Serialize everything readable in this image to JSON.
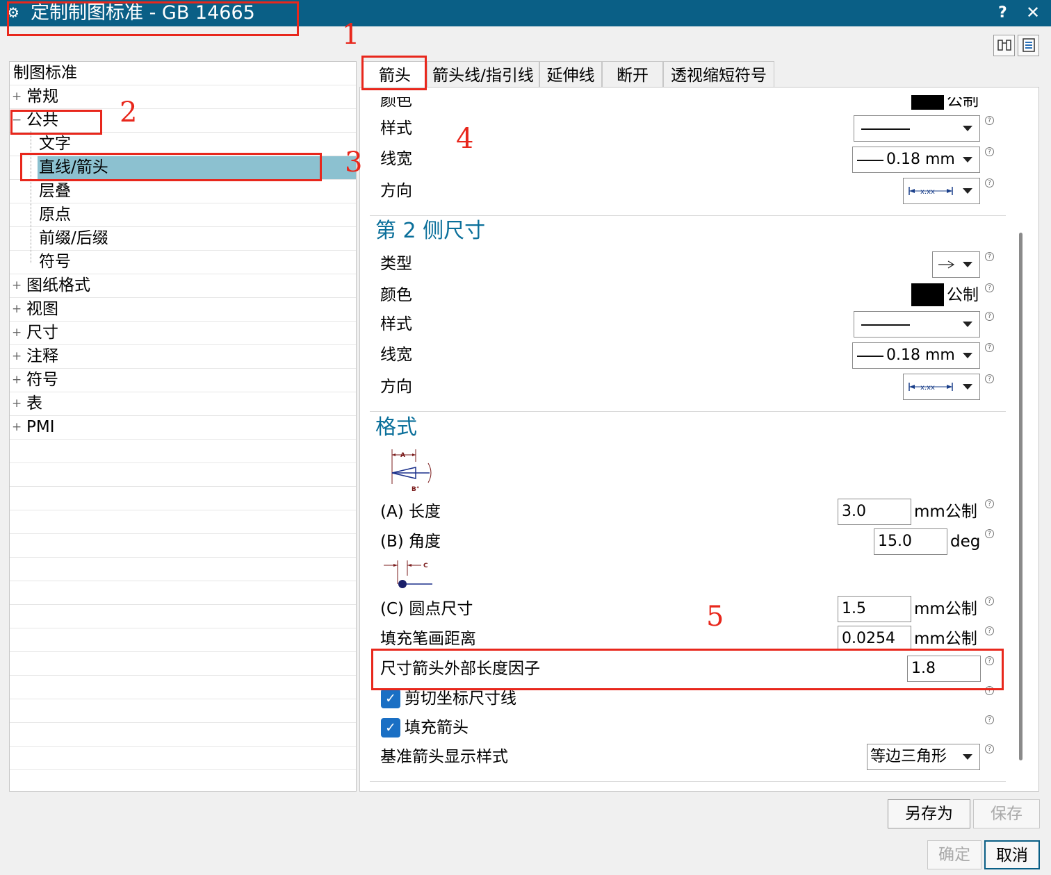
{
  "title": "定制制图标准 - GB 14665",
  "window_controls": {
    "help": "?",
    "close": "✕"
  },
  "toolbar": {
    "icon1": "binoculars-icon",
    "icon2": "list-icon"
  },
  "tree": {
    "root": "制图标准",
    "items": [
      "常规",
      "公共",
      "文字",
      "直线/箭头",
      "层叠",
      "原点",
      "前缀/后缀",
      "符号",
      "图纸格式",
      "视图",
      "尺寸",
      "注释",
      "符号",
      "表",
      "PMI"
    ],
    "selected": "直线/箭头"
  },
  "tabs": [
    "箭头",
    "箭头线/指引线",
    "延伸线",
    "断开",
    "透视缩短符号"
  ],
  "active_tab": "箭头",
  "side1": {
    "color_label": "颜色",
    "color_value": "公制",
    "style_label": "样式",
    "width_label": "线宽",
    "width_value": "0.18 mm",
    "dir_label": "方向"
  },
  "side2": {
    "heading": "第 2 侧尺寸",
    "type_label": "类型",
    "color_label": "颜色",
    "color_value": "公制",
    "style_label": "样式",
    "width_label": "线宽",
    "width_value": "0.18 mm",
    "dir_label": "方向"
  },
  "format": {
    "heading": "格式",
    "diagram1": {
      "a": "A",
      "b": "B°"
    },
    "diagram2": {
      "c": "C"
    },
    "length_label": "(A) 长度",
    "length_value": "3.0",
    "length_unit": "mm",
    "angle_label": "(B) 角度",
    "angle_value": "15.0",
    "angle_unit": "deg",
    "dot_label": "(C) 圆点尺寸",
    "dot_value": "1.5",
    "dot_unit": "mm",
    "fill_label": "填充笔画距离",
    "fill_value": "0.0254",
    "fill_unit": "mm",
    "factor_label": "尺寸箭头外部长度因子",
    "factor_value": "1.8",
    "clip_label": "剪切坐标尺寸线",
    "clip_checked": true,
    "fillarrow_label": "填充箭头",
    "fillarrow_checked": true,
    "datum_label": "基准箭头显示样式",
    "datum_value": "等边三角形",
    "unit_system": "公制"
  },
  "buttons": {
    "save_as": "另存为",
    "save": "保存",
    "ok": "确定",
    "cancel": "取消"
  },
  "annotations": [
    "1",
    "2",
    "3",
    "4",
    "5"
  ],
  "colors": {
    "titlebar": "#0a5f86",
    "accent": "#0a6f9a",
    "selection": "#8cc1d0",
    "annotation": "#e8271c",
    "checkbox": "#1a6fc4"
  }
}
